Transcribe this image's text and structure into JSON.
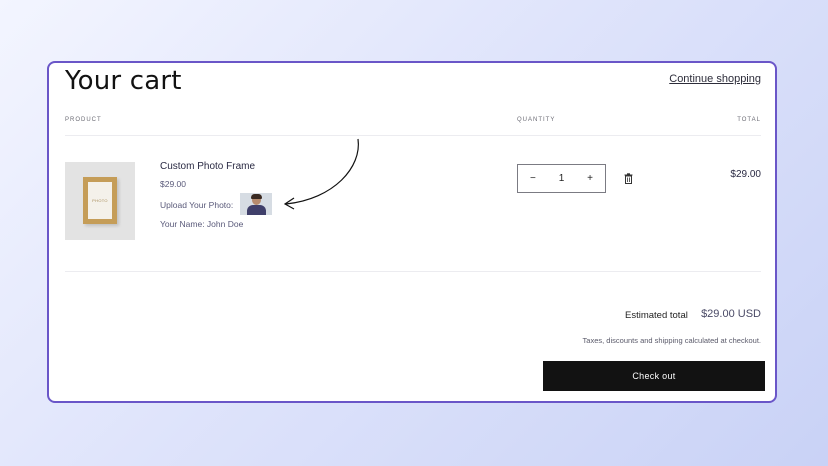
{
  "cart": {
    "title": "Your cart",
    "continue_label": "Continue shopping",
    "headers": {
      "product": "PRODUCT",
      "quantity": "QUANTITY",
      "total": "TOTAL"
    }
  },
  "item": {
    "name": "Custom Photo Frame",
    "price": "$29.00",
    "photo_label": "Upload Your Photo:",
    "name_field": "Your Name: John Doe",
    "frame_text": "PHOTO",
    "quantity": "1",
    "minus": "−",
    "plus": "+",
    "line_total": "$29.00"
  },
  "summary": {
    "estimated_label": "Estimated total",
    "estimated_value": "$29.00 USD",
    "tax_note": "Taxes, discounts and shipping calculated at checkout.",
    "checkout_label": "Check out"
  },
  "colors": {
    "border": "#6a56c8",
    "checkout_bg": "#121212"
  }
}
